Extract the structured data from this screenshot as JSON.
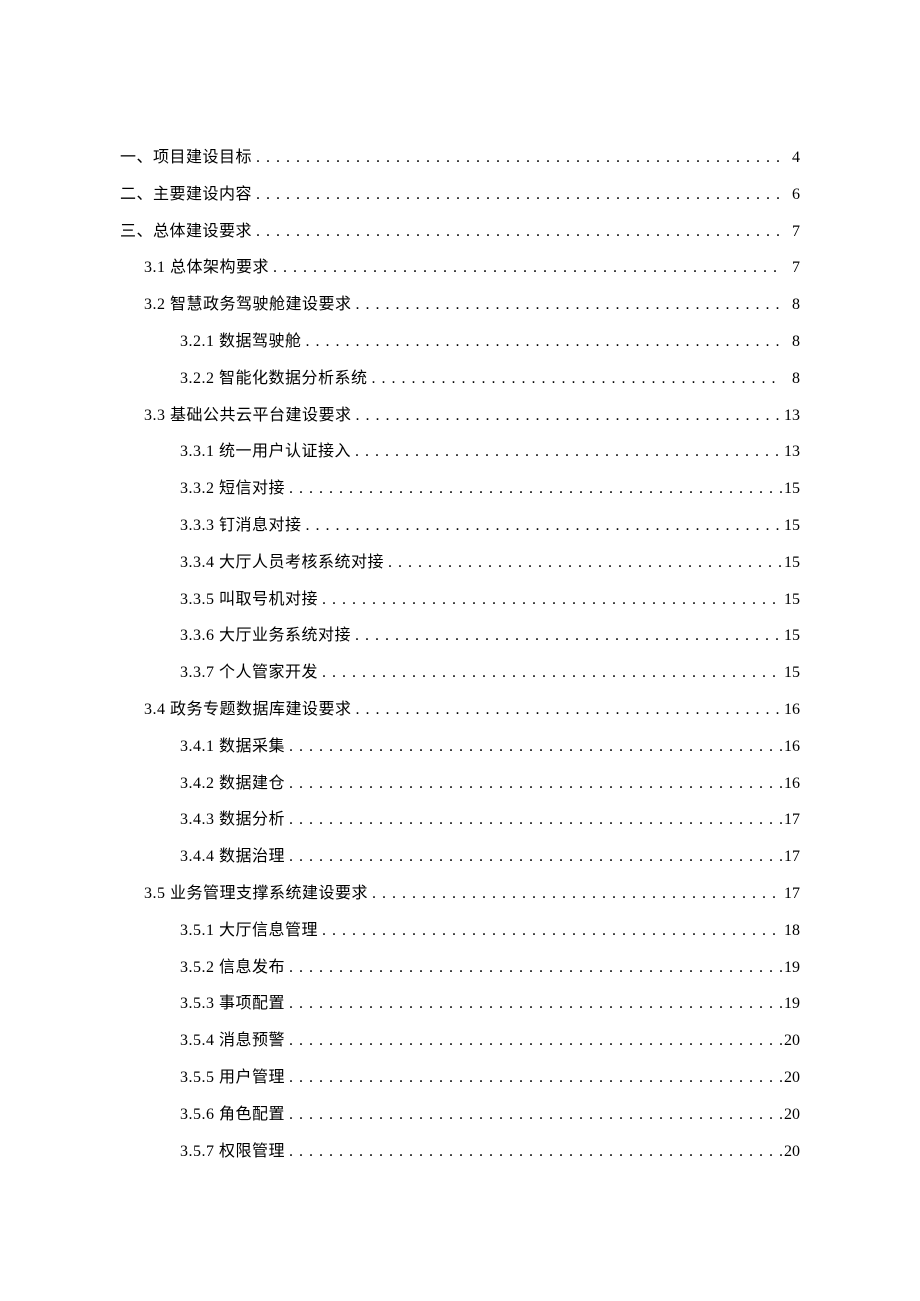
{
  "toc": [
    {
      "level": 1,
      "title": "一、项目建设目标",
      "page": "4"
    },
    {
      "level": 1,
      "title": "二、主要建设内容",
      "page": "6"
    },
    {
      "level": 1,
      "title": "三、总体建设要求",
      "page": "7"
    },
    {
      "level": 2,
      "title": "3.1 总体架构要求",
      "page": "7"
    },
    {
      "level": 2,
      "title": "3.2 智慧政务驾驶舱建设要求",
      "page": "8"
    },
    {
      "level": 3,
      "title": "3.2.1 数据驾驶舱",
      "page": "8"
    },
    {
      "level": 3,
      "title": "3.2.2 智能化数据分析系统",
      "page": "8"
    },
    {
      "level": 2,
      "title": "3.3 基础公共云平台建设要求",
      "page": "13"
    },
    {
      "level": 3,
      "title": "3.3.1 统一用户认证接入",
      "page": "13"
    },
    {
      "level": 3,
      "title": "3.3.2 短信对接",
      "page": "15"
    },
    {
      "level": 3,
      "title": "3.3.3 钉消息对接",
      "page": "15"
    },
    {
      "level": 3,
      "title": "3.3.4 大厅人员考核系统对接",
      "page": "15"
    },
    {
      "level": 3,
      "title": "3.3.5 叫取号机对接",
      "page": "15"
    },
    {
      "level": 3,
      "title": "3.3.6 大厅业务系统对接",
      "page": "15"
    },
    {
      "level": 3,
      "title": "3.3.7 个人管家开发",
      "page": "15"
    },
    {
      "level": 2,
      "title": "3.4 政务专题数据库建设要求",
      "page": "16"
    },
    {
      "level": 3,
      "title": "3.4.1 数据采集",
      "page": "16"
    },
    {
      "level": 3,
      "title": "3.4.2 数据建仓",
      "page": "16"
    },
    {
      "level": 3,
      "title": "3.4.3 数据分析",
      "page": "17"
    },
    {
      "level": 3,
      "title": "3.4.4 数据治理",
      "page": "17"
    },
    {
      "level": 2,
      "title": "3.5 业务管理支撑系统建设要求",
      "page": "17"
    },
    {
      "level": 3,
      "title": "3.5.1 大厅信息管理",
      "page": "18"
    },
    {
      "level": 3,
      "title": "3.5.2 信息发布",
      "page": "19"
    },
    {
      "level": 3,
      "title": "3.5.3 事项配置",
      "page": "19"
    },
    {
      "level": 3,
      "title": "3.5.4 消息预警",
      "page": "20"
    },
    {
      "level": 3,
      "title": "3.5.5 用户管理",
      "page": "20"
    },
    {
      "level": 3,
      "title": "3.5.6 角色配置",
      "page": "20"
    },
    {
      "level": 3,
      "title": "3.5.7 权限管理",
      "page": "20"
    }
  ]
}
